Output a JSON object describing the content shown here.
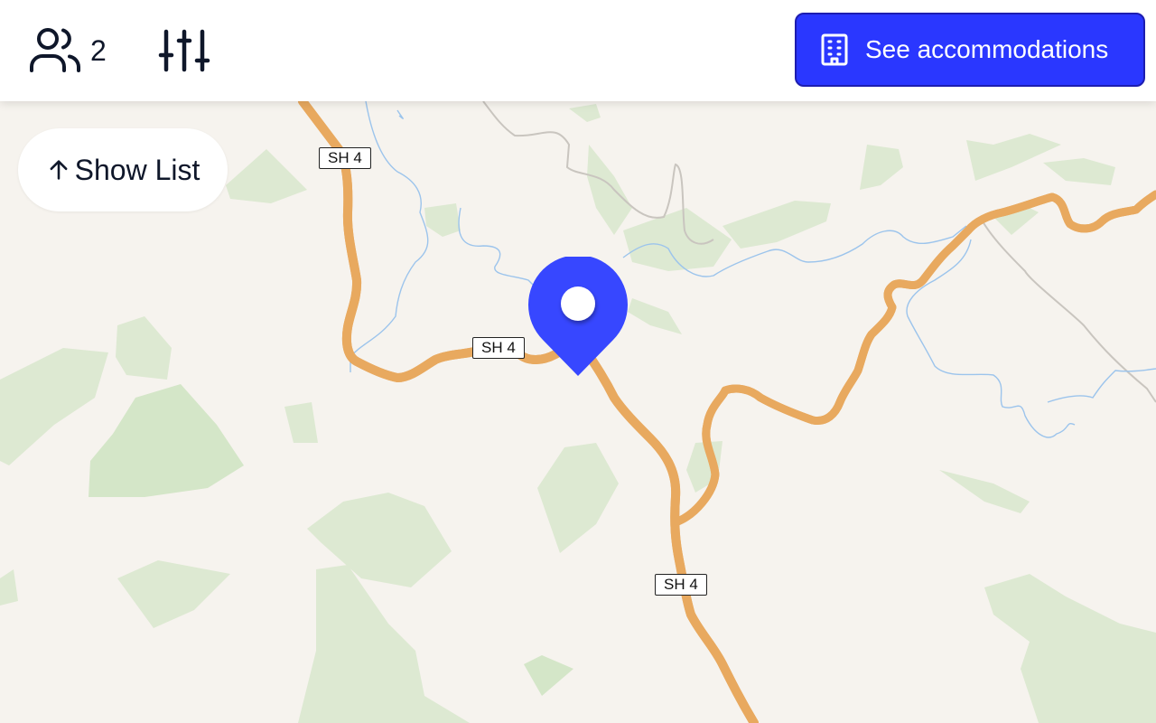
{
  "header": {
    "guests": {
      "icon": "users-icon",
      "count": "2"
    },
    "filters": {
      "icon": "sliders-icon"
    },
    "accommodations_button": {
      "icon": "building-icon",
      "label": "See accommodations"
    }
  },
  "map": {
    "show_list": {
      "icon": "arrow-up-icon",
      "label": "Show List"
    },
    "road_shields": [
      "SH 4",
      "SH 4",
      "SH 4"
    ],
    "marker": {
      "icon": "map-pin-icon"
    }
  },
  "colors": {
    "accent": "#2a37ff",
    "map_background": "#f6f3ee",
    "forest": "#d9e8cf",
    "road_fill": "#fcd990",
    "road_casing": "#e8a95f",
    "water": "#9cc4ec",
    "track": "#c9c5bf"
  }
}
